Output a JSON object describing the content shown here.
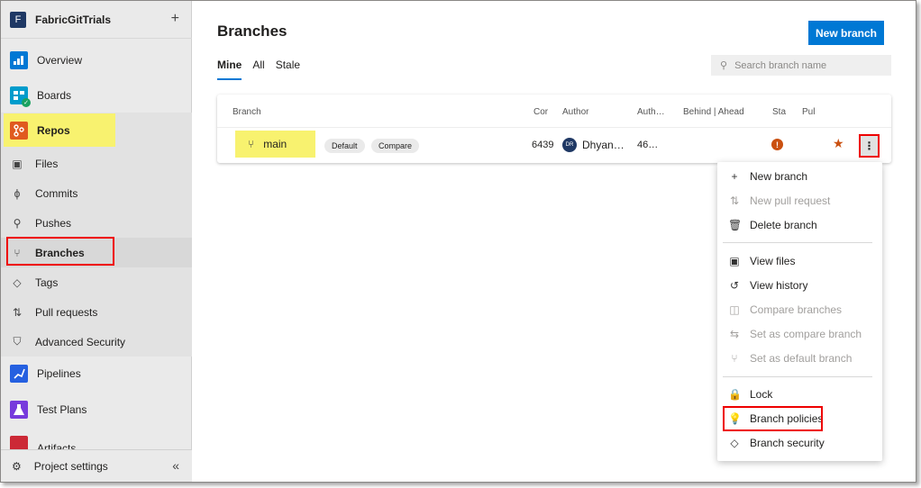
{
  "project": {
    "initial": "F",
    "name": "FabricGitTrials",
    "add_icon": "+"
  },
  "nav": [
    {
      "label": "Overview",
      "color": "#0078d4"
    },
    {
      "label": "Boards",
      "color": "#009ccc"
    },
    {
      "label": "Repos",
      "color": "#e05a1f"
    },
    {
      "label": "Pipelines",
      "color": "#2560e0"
    },
    {
      "label": "Test Plans",
      "color": "#773adc"
    },
    {
      "label": "Artifacts",
      "color": "#cc2936"
    }
  ],
  "repos_sub": [
    {
      "label": "Files",
      "icon": "file-icon"
    },
    {
      "label": "Commits",
      "icon": "commit-icon"
    },
    {
      "label": "Pushes",
      "icon": "push-icon"
    },
    {
      "label": "Branches",
      "icon": "branch-icon"
    },
    {
      "label": "Tags",
      "icon": "tag-icon"
    },
    {
      "label": "Pull requests",
      "icon": "pull-request-icon"
    },
    {
      "label": "Advanced Security",
      "icon": "shield-icon"
    }
  ],
  "settings": {
    "label": "Project settings",
    "collapse": "«"
  },
  "page": {
    "title": "Branches",
    "new_branch": "New branch",
    "tabs": [
      "Mine",
      "All",
      "Stale"
    ],
    "search_placeholder": "Search branch name"
  },
  "table": {
    "headers": {
      "branch": "Branch",
      "commit": "Cor",
      "author": "Author",
      "authored": "Auth…",
      "behind_ahead": "Behind | Ahead",
      "status": "Sta",
      "pull": "Pul"
    },
    "rows": [
      {
        "name": "main",
        "default": "Default",
        "compare": "Compare",
        "commit": "6439",
        "avatar": "DR",
        "author": "Dhyan…",
        "authored": "46…",
        "status": "!"
      }
    ]
  },
  "menu": [
    {
      "label": "New branch",
      "icon": "+",
      "disabled": false
    },
    {
      "label": "New pull request",
      "icon": "⇅",
      "disabled": true
    },
    {
      "label": "Delete branch",
      "icon": "🗑",
      "disabled": false
    },
    {
      "label": "View files",
      "icon": "▣",
      "disabled": false
    },
    {
      "label": "View history",
      "icon": "↺",
      "disabled": false
    },
    {
      "label": "Compare branches",
      "icon": "◫",
      "disabled": true
    },
    {
      "label": "Set as compare branch",
      "icon": "⇆",
      "disabled": true
    },
    {
      "label": "Set as default branch",
      "icon": "⑂",
      "disabled": true
    },
    {
      "label": "Lock",
      "icon": "🔒",
      "disabled": false
    },
    {
      "label": "Branch policies",
      "icon": "💡",
      "disabled": false
    },
    {
      "label": "Branch security",
      "icon": "◇",
      "disabled": false
    }
  ],
  "colors": {
    "accent": "#0078d4",
    "highlight": "#f8f26f",
    "annotation": "#e00000"
  }
}
